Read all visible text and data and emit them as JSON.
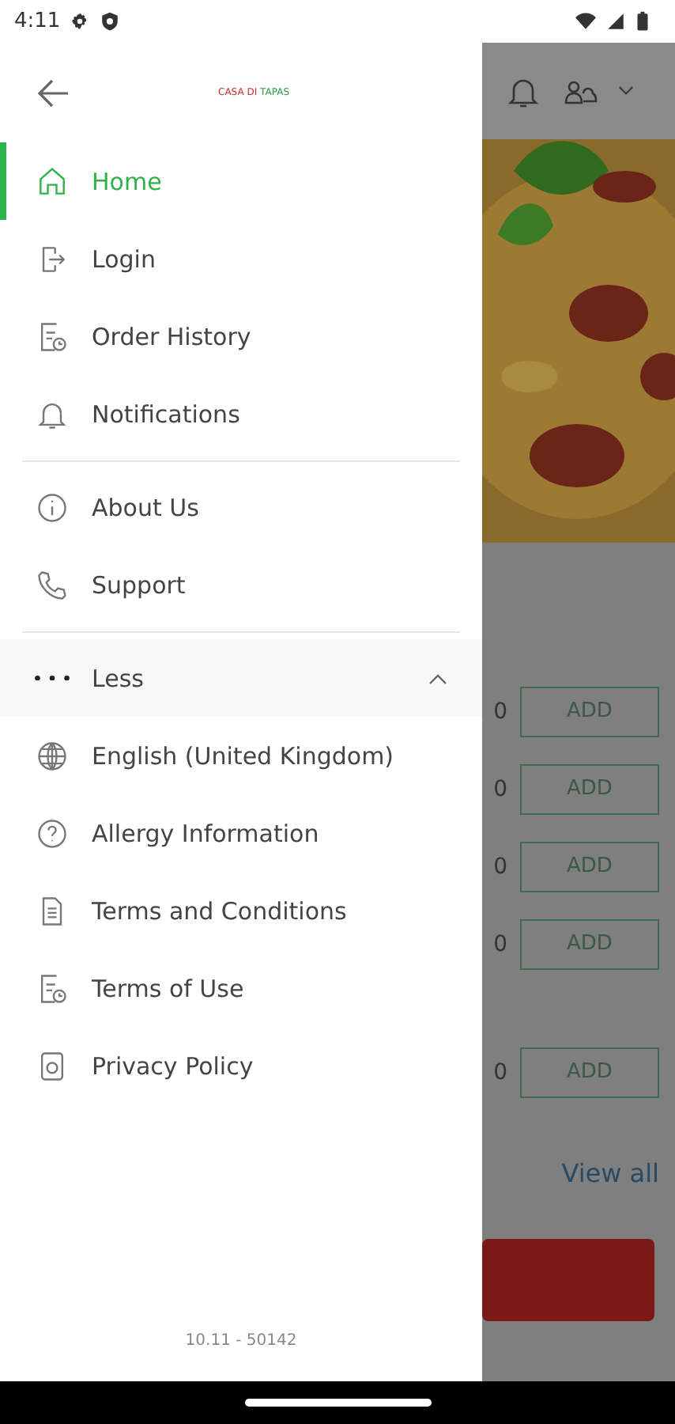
{
  "status_bar": {
    "time": "4:11"
  },
  "drawer": {
    "logo": {
      "part_1": "CASA DI",
      "part_2": "TAPAS"
    },
    "main_items": [
      {
        "label": "Home",
        "selected": true
      },
      {
        "label": "Login",
        "selected": false
      },
      {
        "label": "Order History",
        "selected": false
      },
      {
        "label": "Notifications",
        "selected": false
      }
    ],
    "info_items": [
      {
        "label": "About Us",
        "selected": false
      },
      {
        "label": "Support",
        "selected": false
      }
    ],
    "more": {
      "label": "Less",
      "expanded": true
    },
    "extra_items": [
      {
        "label": "English (United Kingdom)",
        "selected": false
      },
      {
        "label": "Allergy Information",
        "selected": false
      },
      {
        "label": "Terms and Conditions",
        "selected": false
      },
      {
        "label": "Terms of Use",
        "selected": false
      },
      {
        "label": "Privacy Policy",
        "selected": false
      }
    ],
    "version": "10.11 - 50142"
  },
  "background": {
    "rows": [
      {
        "price": "0",
        "button": "ADD"
      },
      {
        "price": "0",
        "button": "ADD"
      },
      {
        "price": "0",
        "button": "ADD"
      },
      {
        "price": "0",
        "button": "ADD"
      },
      {
        "price": "0",
        "button": "ADD"
      }
    ],
    "view_all": "View all"
  }
}
